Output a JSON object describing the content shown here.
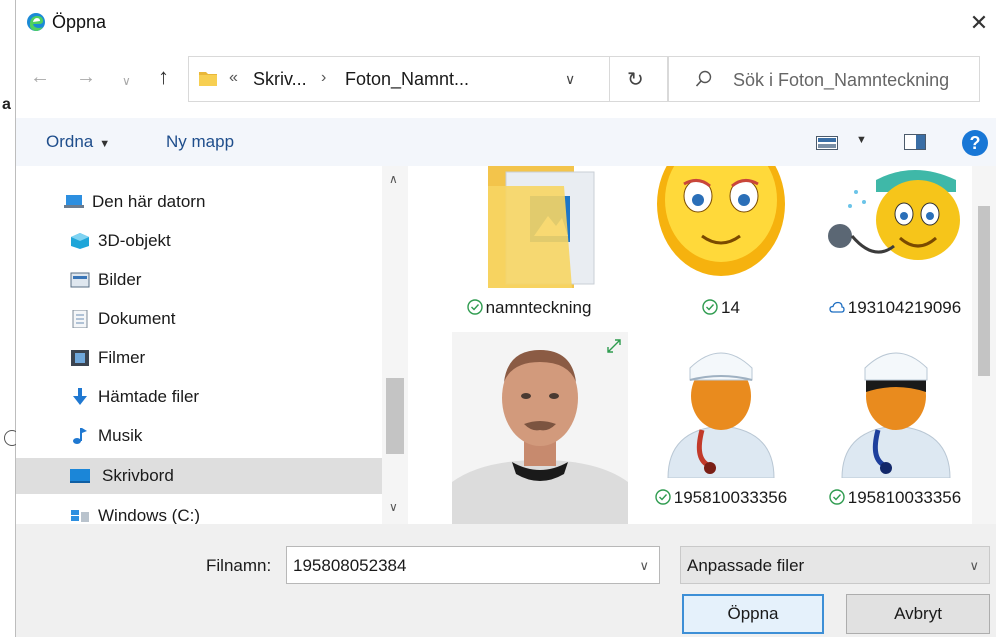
{
  "window": {
    "title": "Öppna",
    "close_glyph": "✕"
  },
  "background_edge": {
    "letter": "a"
  },
  "nav": {
    "back_glyph": "←",
    "forward_glyph": "→",
    "recent_glyph": "∨",
    "up_glyph": "↑"
  },
  "address": {
    "overflow": "«",
    "crumbs": [
      "Skriv...",
      "Foton_Namnt..."
    ],
    "separator": "›",
    "dropdown_glyph": "∨",
    "refresh_glyph": "↻"
  },
  "search": {
    "placeholder": "Sök i Foton_Namnteckning"
  },
  "toolbar": {
    "organize_label": "Ordna",
    "organize_caret": "▼",
    "new_folder_label": "Ny mapp",
    "view_caret": "▼",
    "help_glyph": "?"
  },
  "tree": {
    "items": [
      {
        "label": "Den här datorn",
        "icon": "computer-icon",
        "level": "root"
      },
      {
        "label": "3D-objekt",
        "icon": "3d-objects-icon",
        "level": "child"
      },
      {
        "label": "Bilder",
        "icon": "pictures-icon",
        "level": "child"
      },
      {
        "label": "Dokument",
        "icon": "documents-icon",
        "level": "child"
      },
      {
        "label": "Filmer",
        "icon": "videos-icon",
        "level": "child"
      },
      {
        "label": "Hämtade filer",
        "icon": "downloads-icon",
        "level": "child"
      },
      {
        "label": "Musik",
        "icon": "music-icon",
        "level": "child"
      },
      {
        "label": "Skrivbord",
        "icon": "desktop-icon",
        "level": "child",
        "selected": true
      },
      {
        "label": "Windows (C:)",
        "icon": "drive-icon",
        "level": "child"
      }
    ],
    "scroll_up": "∧",
    "scroll_down": "∨"
  },
  "files": [
    {
      "name": "namnteckning",
      "kind": "folder",
      "status": "synced"
    },
    {
      "name": "14",
      "kind": "smiley-woman",
      "status": "synced"
    },
    {
      "name": "193104219096",
      "kind": "smiley-doctor",
      "status": "cloud"
    },
    {
      "name": "",
      "kind": "photo-man",
      "status": ""
    },
    {
      "name": "195810033356",
      "kind": "nurse-red",
      "status": "synced"
    },
    {
      "name": "195810033356",
      "kind": "nurse-blue",
      "status": "synced"
    }
  ],
  "bottom": {
    "filename_label": "Filnamn:",
    "filename_value": "195808052384",
    "filetype_value": "Anpassade filer",
    "dropdown_glyph": "∨",
    "open_label": "Öppna",
    "cancel_label": "Avbryt"
  },
  "colors": {
    "accent": "#1877d6",
    "link": "#1f4e8c",
    "selected_row": "#dedede",
    "synced": "#2e9b4f",
    "cloud": "#1f6fc2"
  }
}
